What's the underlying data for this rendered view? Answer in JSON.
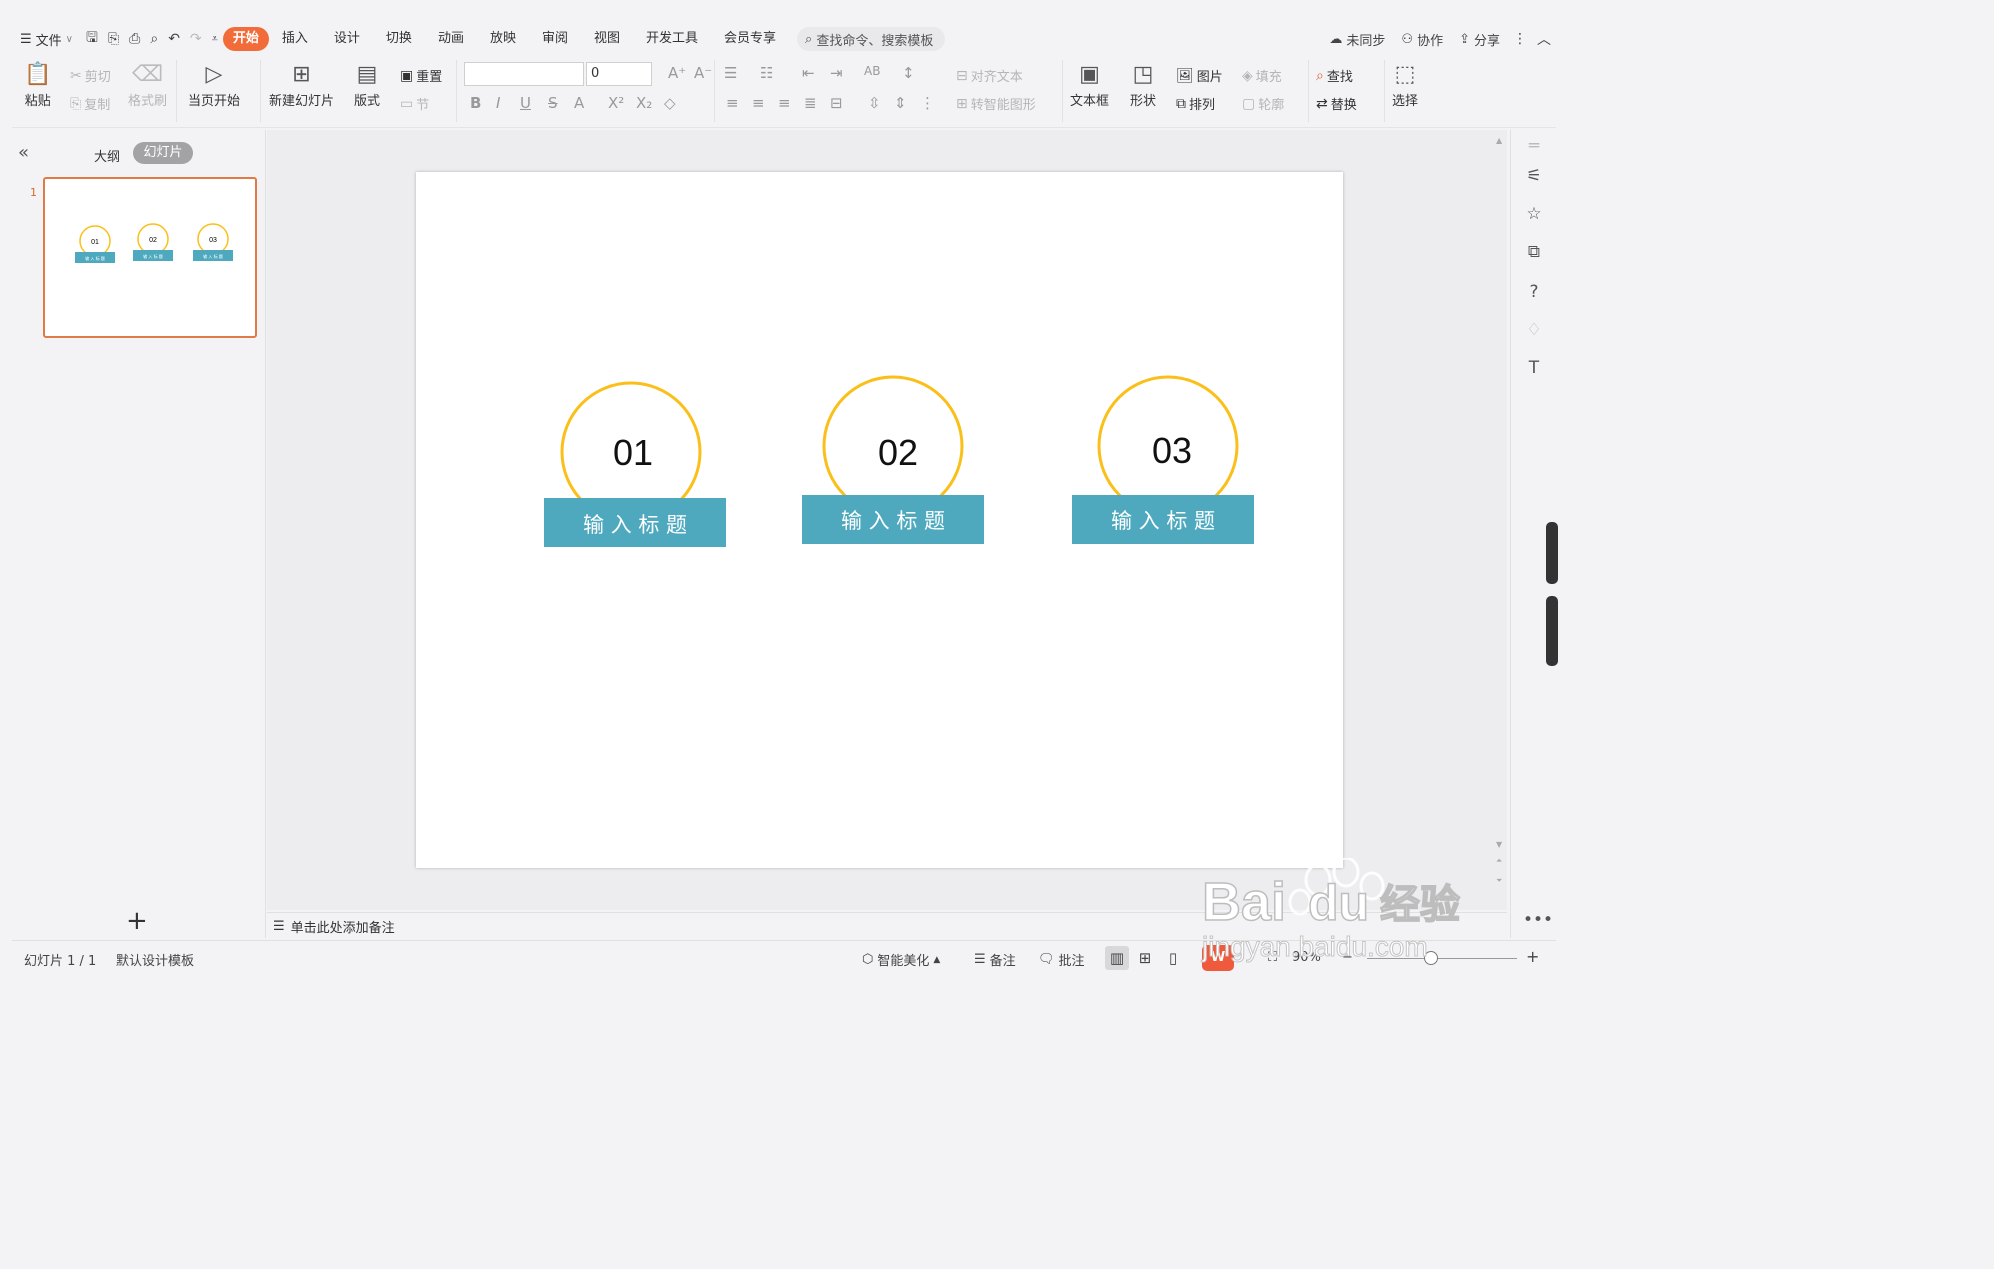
{
  "menu": {
    "file_label": "文件",
    "tabs": [
      "开始",
      "插入",
      "设计",
      "切换",
      "动画",
      "放映",
      "审阅",
      "视图",
      "开发工具",
      "会员专享"
    ],
    "active_tab": "开始",
    "search_placeholder": "查找命令、搜索模板",
    "sync_label": "未同步",
    "collab_label": "协作",
    "share_label": "分享"
  },
  "ribbon": {
    "paste": "粘贴",
    "cut": "剪切",
    "copy": "复制",
    "format_painter": "格式刷",
    "play_from_current": "当页开始",
    "new_slide": "新建幻灯片",
    "layout": "版式",
    "reset": "重置",
    "section": "节",
    "font_size_value": "0",
    "align_text": "对齐文本",
    "smart_shape": "转智能图形",
    "textbox": "文本框",
    "shape": "形状",
    "picture": "图片",
    "arrange": "排列",
    "fill": "填充",
    "outline": "轮廓",
    "find": "查找",
    "replace": "替换",
    "select": "选择"
  },
  "left_panel": {
    "outline_tab": "大纲",
    "slides_tab": "幻灯片",
    "slide_number": "1"
  },
  "slide": {
    "items": [
      {
        "number": "01",
        "title": "输 入 标 题"
      },
      {
        "number": "02",
        "title": "输 入 标 题"
      },
      {
        "number": "03",
        "title": "输 入 标 题"
      }
    ],
    "accent_circle": "#fbbf1a",
    "accent_banner": "#4ea9bf"
  },
  "notes_placeholder": "单击此处添加备注",
  "status": {
    "slide_counter": "幻灯片 1 / 1",
    "template": "默认设计模板",
    "beautify": "智能美化",
    "notes": "备注",
    "comments": "批注",
    "zoom": "90%"
  },
  "watermark": {
    "brand": "Bai",
    "brand2": "du",
    "cn": "经验",
    "url": "jingyan.baidu.com"
  }
}
